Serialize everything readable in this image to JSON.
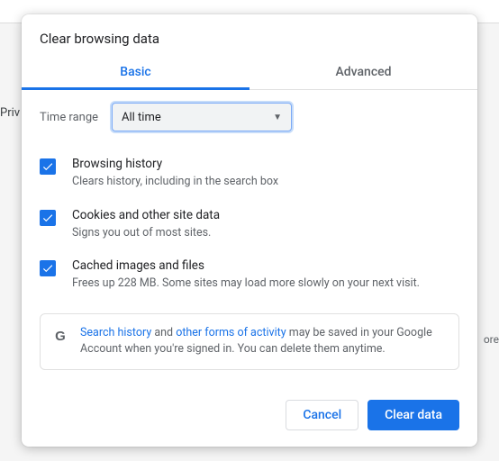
{
  "background": {
    "side_label": "Priv",
    "more_text": "ore"
  },
  "dialog": {
    "title": "Clear browsing data",
    "tabs": {
      "basic": "Basic",
      "advanced": "Advanced"
    },
    "time_range": {
      "label": "Time range",
      "value": "All time"
    },
    "options": [
      {
        "title": "Browsing history",
        "desc": "Clears history, including in the search box",
        "checked": true
      },
      {
        "title": "Cookies and other site data",
        "desc": "Signs you out of most sites.",
        "checked": true
      },
      {
        "title": "Cached images and files",
        "desc": "Frees up 228 MB. Some sites may load more slowly on your next visit.",
        "checked": true
      }
    ],
    "notice": {
      "link1": "Search history",
      "mid1": " and ",
      "link2": "other forms of activity",
      "rest": " may be saved in your Google Account when you're signed in. You can delete them anytime."
    },
    "buttons": {
      "cancel": "Cancel",
      "confirm": "Clear data"
    }
  }
}
